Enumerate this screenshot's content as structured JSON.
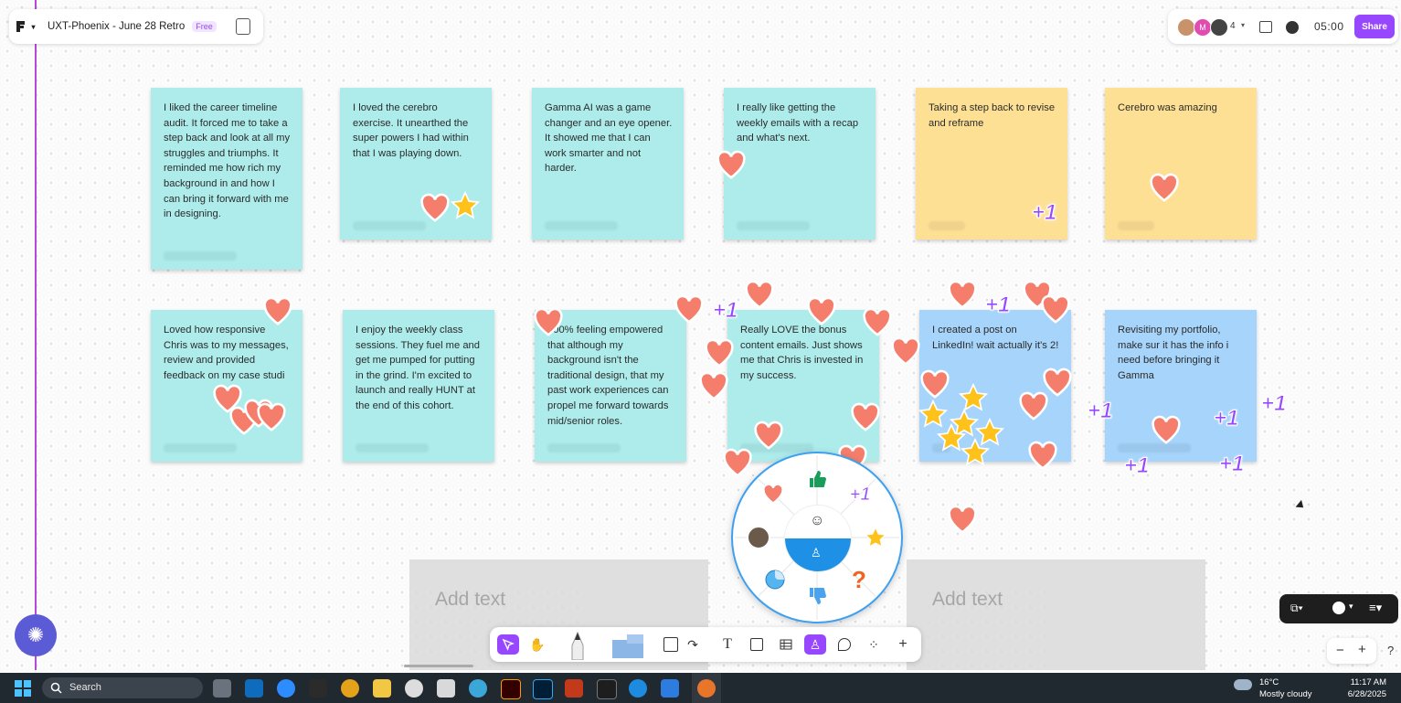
{
  "header": {
    "file_name": "UXT-Phoenix - June 28 Retro",
    "plan_badge": "Free",
    "collaborator_count": "4",
    "timer": "05:00",
    "share_label": "Share"
  },
  "stickies_row1": [
    {
      "text": "I liked the career timeline audit. It forced me to take a step back and look at all my struggles and triumphs. It reminded me how rich my background in and how I can bring it forward with me in designing.",
      "color": "#aeecec"
    },
    {
      "text": "I loved the cerebro exercise. It unearthed the super powers I had within that I was playing down.",
      "color": "#aeecec"
    },
    {
      "text": "Gamma AI was a game changer and an eye opener. It showed me that I can work smarter and not harder.",
      "color": "#aeecec"
    },
    {
      "text": "I really like getting the weekly emails with a recap and what's next.",
      "color": "#aeecec"
    },
    {
      "text": "Taking a step back to revise and reframe",
      "color": "#fee095"
    },
    {
      "text": "Cerebro was amazing",
      "color": "#fee095"
    }
  ],
  "stickies_row2": [
    {
      "text": "Loved how responsive Chris was to my messages, review and provided feedback on my case studi",
      "color": "#aeecec"
    },
    {
      "text": "I enjoy the weekly class sessions. They fuel me and get me pumped for putting in the grind. I'm excited to launch and really HUNT at the end of this cohort.",
      "color": "#aeecec"
    },
    {
      "text": "100% feeling empowered that although my background isn't the traditional design, that my past work experiences can propel me forward towards mid/senior roles.",
      "color": "#aeecec"
    },
    {
      "text": "Really LOVE the bonus content emails. Just shows me that Chris is invested in my success.",
      "color": "#aeecec"
    },
    {
      "text": "I created a post on LinkedIn! wait actually it's 2!",
      "color": "#a6d4fb"
    },
    {
      "text": "Revisiting my portfolio, make sur it has the info i need before bringing it Gamma",
      "color": "#a6d4fb"
    }
  ],
  "reaction_plus_one": "+1",
  "add_text_placeholder": "Add text",
  "wheel": {
    "items": [
      "thumbs-up-icon",
      "plus-one",
      "star-icon",
      "question-icon",
      "thumbs-down-icon",
      "sticker-icon",
      "avatar",
      "heart-icon"
    ],
    "plus_label": "+1",
    "question_label": "?"
  },
  "toolbar": {
    "tools": [
      "move",
      "hand",
      "pen",
      "marker",
      "shape",
      "text",
      "section",
      "table",
      "stamp",
      "comment",
      "widgets",
      "more"
    ]
  },
  "taskbar": {
    "search_label": "Search",
    "weather_temp": "16°C",
    "weather_desc": "Mostly cloudy",
    "time": "11:17 AM",
    "date": "6/28/2025"
  },
  "colors": {
    "accent": "#9747ff",
    "heart": "#f47e6b",
    "star": "#ffc21a",
    "wheel_border": "#3ea0f0"
  }
}
